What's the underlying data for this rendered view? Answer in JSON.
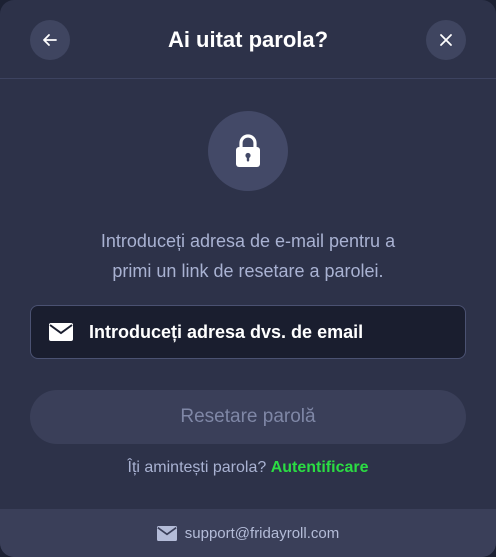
{
  "header": {
    "title": "Ai uitat parola?",
    "back_icon": "arrow-left-icon",
    "close_icon": "close-icon"
  },
  "lock_icon": "lock-icon",
  "description": {
    "line1": "Introduceți adresa de e-mail pentru a",
    "line2": "primi un link de resetare a parolei."
  },
  "email_field": {
    "placeholder": "Introduceți adresa dvs. de email",
    "value": "",
    "icon": "envelope-icon"
  },
  "reset_button": {
    "label": "Resetare parolă"
  },
  "remember": {
    "text": "Îți amintești parola?",
    "link_label": "Autentificare"
  },
  "footer": {
    "support_email": "support@fridayroll.com",
    "icon": "envelope-icon"
  },
  "colors": {
    "background": "#2d3249",
    "accent_green": "#2bdc43",
    "muted_text": "#a9b2d2"
  }
}
